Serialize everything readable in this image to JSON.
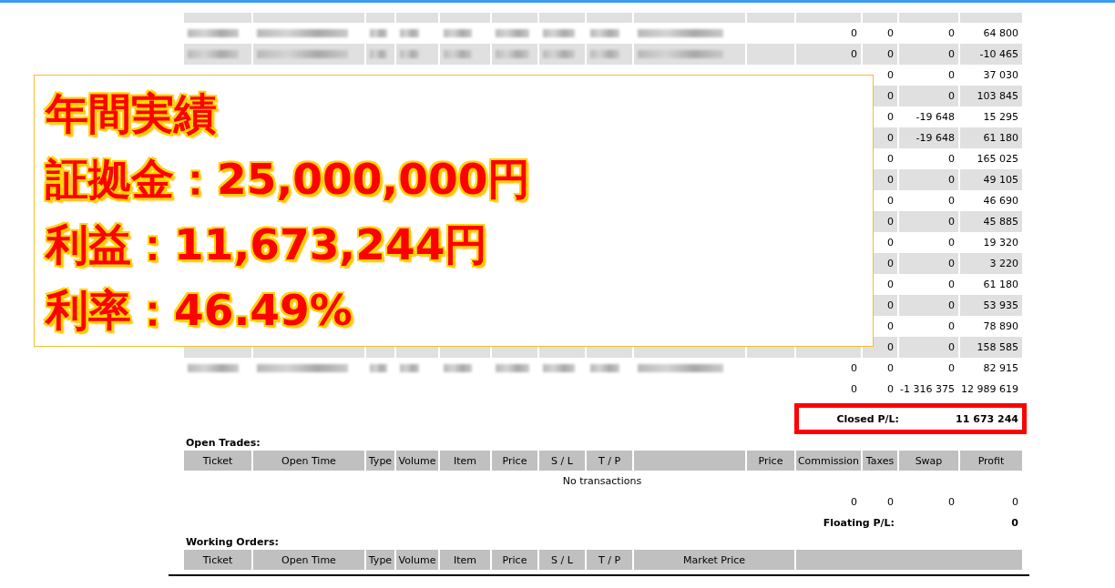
{
  "closed_rows": [
    {
      "commission": "0",
      "taxes": "0",
      "swap": "0",
      "profit": "64 800"
    },
    {
      "commission": "0",
      "taxes": "0",
      "swap": "0",
      "profit": "-10 465"
    },
    {
      "taxes": "0",
      "swap": "0",
      "profit": "37 030"
    },
    {
      "taxes": "0",
      "swap": "0",
      "profit": "103 845"
    },
    {
      "taxes": "0",
      "swap": "-19 648",
      "profit": "15 295"
    },
    {
      "taxes": "0",
      "swap": "-19 648",
      "profit": "61 180"
    },
    {
      "taxes": "0",
      "swap": "0",
      "profit": "165 025"
    },
    {
      "taxes": "0",
      "swap": "0",
      "profit": "49 105"
    },
    {
      "taxes": "0",
      "swap": "0",
      "profit": "46 690"
    },
    {
      "taxes": "0",
      "swap": "0",
      "profit": "45 885"
    },
    {
      "taxes": "0",
      "swap": "0",
      "profit": "19 320"
    },
    {
      "taxes": "0",
      "swap": "0",
      "profit": "3 220"
    },
    {
      "taxes": "0",
      "swap": "0",
      "profit": "61 180"
    },
    {
      "taxes": "0",
      "swap": "0",
      "profit": "53 935"
    },
    {
      "taxes": "0",
      "swap": "0",
      "profit": "78 890"
    },
    {
      "taxes": "0",
      "swap": "0",
      "profit": "158 585"
    },
    {
      "commission": "0",
      "taxes": "0",
      "swap": "0",
      "profit": "82 915"
    }
  ],
  "closed_totals": {
    "commission": "0",
    "taxes": "0",
    "swap": "-1 316 375",
    "profit": "12 989 619"
  },
  "closed_pl": {
    "label": "Closed P/L:",
    "value": "11 673 244"
  },
  "open_trades": {
    "title": "Open Trades:",
    "columns": [
      "Ticket",
      "Open Time",
      "Type",
      "Volume",
      "Item",
      "Price",
      "S / L",
      "T / P",
      "",
      "Price",
      "Commission",
      "Taxes",
      "Swap",
      "Profit"
    ],
    "empty_message": "No transactions",
    "totals": {
      "commission": "0",
      "taxes": "0",
      "swap": "0",
      "profit": "0"
    },
    "floating_pl": {
      "label": "Floating P/L:",
      "value": "0"
    }
  },
  "working_orders": {
    "title": "Working Orders:",
    "columns": [
      "Ticket",
      "Open Time",
      "Type",
      "Volume",
      "Item",
      "Price",
      "S / L",
      "T / P",
      "Market Price",
      ""
    ]
  },
  "overlay": {
    "lines": [
      "年間実績",
      "証拠金：25,000,000円",
      "利益：11,673,244円",
      "利率：46.49%"
    ]
  }
}
